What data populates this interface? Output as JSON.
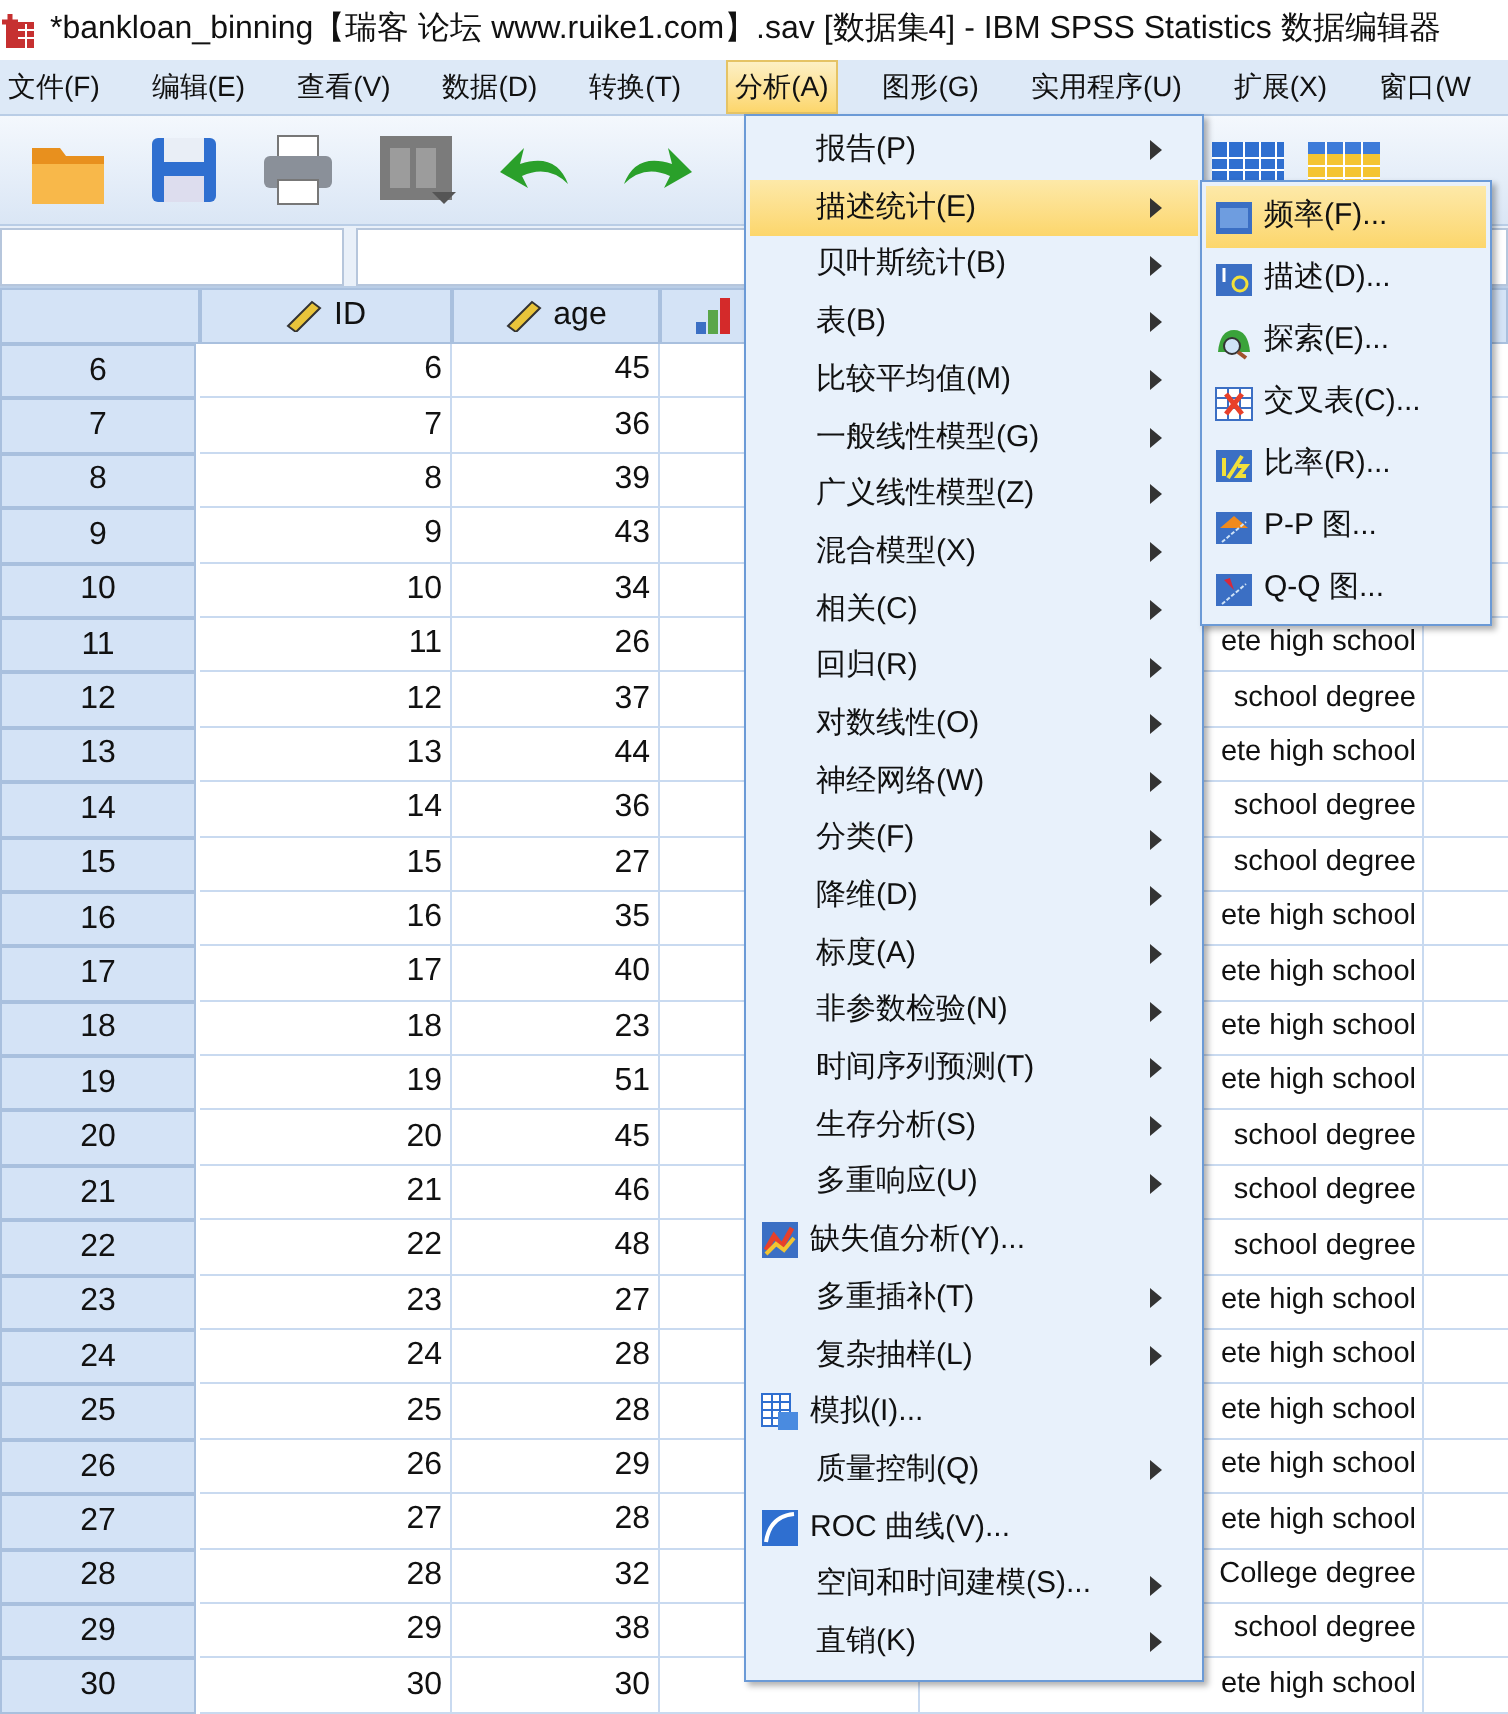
{
  "window": {
    "title": "*bankloan_binning【瑞客 论坛 www.ruike1.com】.sav [数据集4] - IBM SPSS Statistics 数据编辑器"
  },
  "menubar": [
    {
      "label": "文件(F)",
      "selected": false
    },
    {
      "label": "编辑(E)",
      "selected": false
    },
    {
      "label": "查看(V)",
      "selected": false
    },
    {
      "label": "数据(D)",
      "selected": false
    },
    {
      "label": "转换(T)",
      "selected": false
    },
    {
      "label": "分析(A)",
      "selected": true
    },
    {
      "label": "图形(G)",
      "selected": false
    },
    {
      "label": "实用程序(U)",
      "selected": false
    },
    {
      "label": "扩展(X)",
      "selected": false
    },
    {
      "label": "窗口(W",
      "selected": false
    }
  ],
  "table": {
    "columns": [
      "ID",
      "age"
    ],
    "rows": [
      {
        "row": "6",
        "id": "6",
        "age": "45"
      },
      {
        "row": "7",
        "id": "7",
        "age": "36"
      },
      {
        "row": "8",
        "id": "8",
        "age": "39"
      },
      {
        "row": "9",
        "id": "9",
        "age": "43"
      },
      {
        "row": "10",
        "id": "10",
        "age": "34"
      },
      {
        "row": "11",
        "id": "11",
        "age": "26",
        "column_4": "ete high school"
      },
      {
        "row": "12",
        "id": "12",
        "age": "37",
        "column_4": "school degree"
      },
      {
        "row": "13",
        "id": "13",
        "age": "44",
        "column_4": "ete high school"
      },
      {
        "row": "14",
        "id": "14",
        "age": "36",
        "column_4": "school degree"
      },
      {
        "row": "15",
        "id": "15",
        "age": "27",
        "column_4": "school degree"
      },
      {
        "row": "16",
        "id": "16",
        "age": "35",
        "column_4": "ete high school"
      },
      {
        "row": "17",
        "id": "17",
        "age": "40",
        "column_4": "ete high school"
      },
      {
        "row": "18",
        "id": "18",
        "age": "23",
        "column_4": "ete high school"
      },
      {
        "row": "19",
        "id": "19",
        "age": "51",
        "column_4": "ete high school"
      },
      {
        "row": "20",
        "id": "20",
        "age": "45",
        "column_4": "school degree"
      },
      {
        "row": "21",
        "id": "21",
        "age": "46",
        "column_4": "school degree"
      },
      {
        "row": "22",
        "id": "22",
        "age": "48",
        "column_4": "school degree"
      },
      {
        "row": "23",
        "id": "23",
        "age": "27",
        "column_4": "ete high school"
      },
      {
        "row": "24",
        "id": "24",
        "age": "28",
        "column_4": "ete high school"
      },
      {
        "row": "25",
        "id": "25",
        "age": "28",
        "column_4": "ete high school"
      },
      {
        "row": "26",
        "id": "26",
        "age": "29",
        "column_4": "ete high school"
      },
      {
        "row": "27",
        "id": "27",
        "age": "28",
        "column_4": "ete high school"
      },
      {
        "row": "28",
        "id": "28",
        "age": "32",
        "column_4": "College degree"
      },
      {
        "row": "29",
        "id": "29",
        "age": "38",
        "column_4": "school degree"
      },
      {
        "row": "30",
        "id": "30",
        "age": "30",
        "column_4": "ete high school"
      }
    ]
  },
  "analyze_menu": [
    {
      "label": "报告(P)",
      "kind": "submenu",
      "selected": false
    },
    {
      "label": "描述统计(E)",
      "kind": "submenu",
      "selected": true
    },
    {
      "label": "贝叶斯统计(B)",
      "kind": "submenu",
      "selected": false
    },
    {
      "label": "表(B)",
      "kind": "submenu",
      "selected": false
    },
    {
      "label": "比较平均值(M)",
      "kind": "submenu",
      "selected": false
    },
    {
      "label": "一般线性模型(G)",
      "kind": "submenu",
      "selected": false
    },
    {
      "label": "广义线性模型(Z)",
      "kind": "submenu",
      "selected": false
    },
    {
      "label": "混合模型(X)",
      "kind": "submenu",
      "selected": false
    },
    {
      "label": "相关(C)",
      "kind": "submenu",
      "selected": false
    },
    {
      "label": "回归(R)",
      "kind": "submenu",
      "selected": false
    },
    {
      "label": "对数线性(O)",
      "kind": "submenu",
      "selected": false
    },
    {
      "label": "神经网络(W)",
      "kind": "submenu",
      "selected": false
    },
    {
      "label": "分类(F)",
      "kind": "submenu",
      "selected": false
    },
    {
      "label": "降维(D)",
      "kind": "submenu",
      "selected": false
    },
    {
      "label": "标度(A)",
      "kind": "submenu",
      "selected": false
    },
    {
      "label": "非参数检验(N)",
      "kind": "submenu",
      "selected": false
    },
    {
      "label": "时间序列预测(T)",
      "kind": "submenu",
      "selected": false
    },
    {
      "label": "生存分析(S)",
      "kind": "submenu",
      "selected": false
    },
    {
      "label": "多重响应(U)",
      "kind": "submenu",
      "selected": false
    },
    {
      "label": "缺失值分析(Y)...",
      "kind": "dialog",
      "selected": false
    },
    {
      "label": "多重插补(T)",
      "kind": "submenu",
      "selected": false
    },
    {
      "label": "复杂抽样(L)",
      "kind": "submenu",
      "selected": false
    },
    {
      "label": "模拟(I)...",
      "kind": "dialog",
      "selected": false
    },
    {
      "label": "质量控制(Q)",
      "kind": "submenu",
      "selected": false
    },
    {
      "label": "ROC 曲线(V)...",
      "kind": "dialog",
      "selected": false
    },
    {
      "label": "空间和时间建模(S)...",
      "kind": "submenu",
      "selected": false
    },
    {
      "label": "直销(K)",
      "kind": "submenu",
      "selected": false
    }
  ],
  "descriptive_submenu": [
    {
      "label": "频率(F)...",
      "selected": true
    },
    {
      "label": "描述(D)...",
      "selected": false
    },
    {
      "label": "探索(E)...",
      "selected": false
    },
    {
      "label": "交叉表(C)...",
      "selected": false
    },
    {
      "label": "比率(R)...",
      "selected": false
    },
    {
      "label": "P-P 图...",
      "selected": false
    },
    {
      "label": "Q-Q 图...",
      "selected": false
    }
  ]
}
